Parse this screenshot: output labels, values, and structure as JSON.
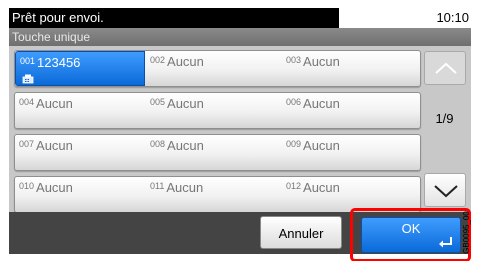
{
  "status": {
    "message": "Prêt pour envoi.",
    "time": "10:10"
  },
  "header": {
    "title": "Touche unique"
  },
  "rows": [
    [
      {
        "num": "001",
        "name": "123456"
      },
      {
        "num": "002",
        "name": "Aucun"
      },
      {
        "num": "003",
        "name": "Aucun"
      }
    ],
    [
      {
        "num": "004",
        "name": "Aucun"
      },
      {
        "num": "005",
        "name": "Aucun"
      },
      {
        "num": "006",
        "name": "Aucun"
      }
    ],
    [
      {
        "num": "007",
        "name": "Aucun"
      },
      {
        "num": "008",
        "name": "Aucun"
      },
      {
        "num": "009",
        "name": "Aucun"
      }
    ],
    [
      {
        "num": "010",
        "name": "Aucun"
      },
      {
        "num": "011",
        "name": "Aucun"
      },
      {
        "num": "012",
        "name": "Aucun"
      }
    ]
  ],
  "pagination": {
    "indicator": "1/9"
  },
  "footer": {
    "cancel_label": "Annuler",
    "ok_label": "OK"
  },
  "side_code": "GB0095_00",
  "icons": {
    "scroll_up": "chevron-up-icon",
    "scroll_down": "chevron-down-icon",
    "fax": "fax-icon",
    "enter": "enter-icon"
  },
  "colors": {
    "selected": "#1a7fe8",
    "highlight": "#ff0000",
    "header": "#7a7a7a"
  }
}
